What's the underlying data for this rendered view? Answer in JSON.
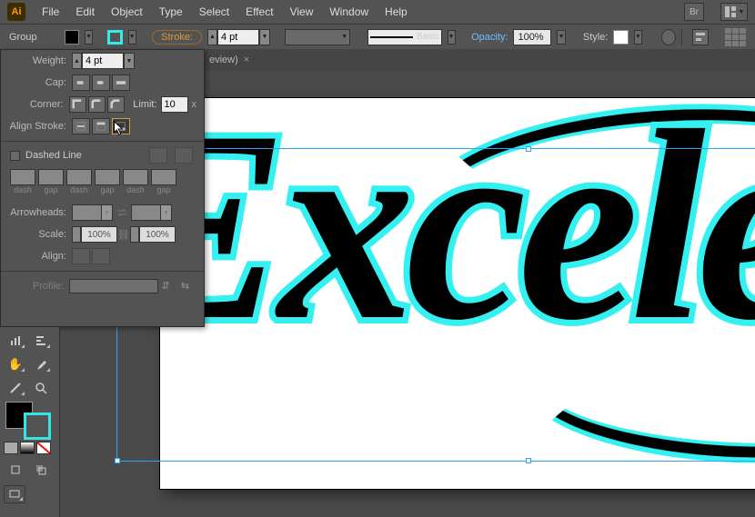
{
  "app": {
    "logo": "Ai"
  },
  "menus": [
    "File",
    "Edit",
    "Object",
    "Type",
    "Select",
    "Effect",
    "View",
    "Window",
    "Help"
  ],
  "controlbar": {
    "selection_label": "Group",
    "fill_color": "#000000",
    "stroke_color": "#35eaea",
    "stroke_link": "Stroke:",
    "stroke_weight": "4 pt",
    "brush_name": "Basic",
    "opacity_link": "Opacity:",
    "opacity_value": "100%",
    "style_label": "Style:",
    "style_swatch": "#ffffff"
  },
  "tab": {
    "label": "eview)",
    "close": "×"
  },
  "stroke_panel": {
    "weight_label": "Weight:",
    "weight_value": "4 pt",
    "cap_label": "Cap:",
    "corner_label": "Corner:",
    "limit_label": "Limit:",
    "limit_value": "10",
    "limit_suffix": "x",
    "align_label": "Align Stroke:",
    "dashed_label": "Dashed Line",
    "dash_labels": [
      "dash",
      "gap",
      "dash",
      "gap",
      "dash",
      "gap"
    ],
    "arrowheads_label": "Arrowheads:",
    "scale_label": "Scale:",
    "scale_a": "100%",
    "scale_b": "100%",
    "align_arrow_label": "Align:",
    "profile_label": "Profile:"
  },
  "artwork": {
    "text": "Excele"
  },
  "colors": {
    "cyan": "#35eaea",
    "orange": "#d99a3a",
    "link_blue": "#6fbfff",
    "sel_blue": "#2aa6ff"
  }
}
